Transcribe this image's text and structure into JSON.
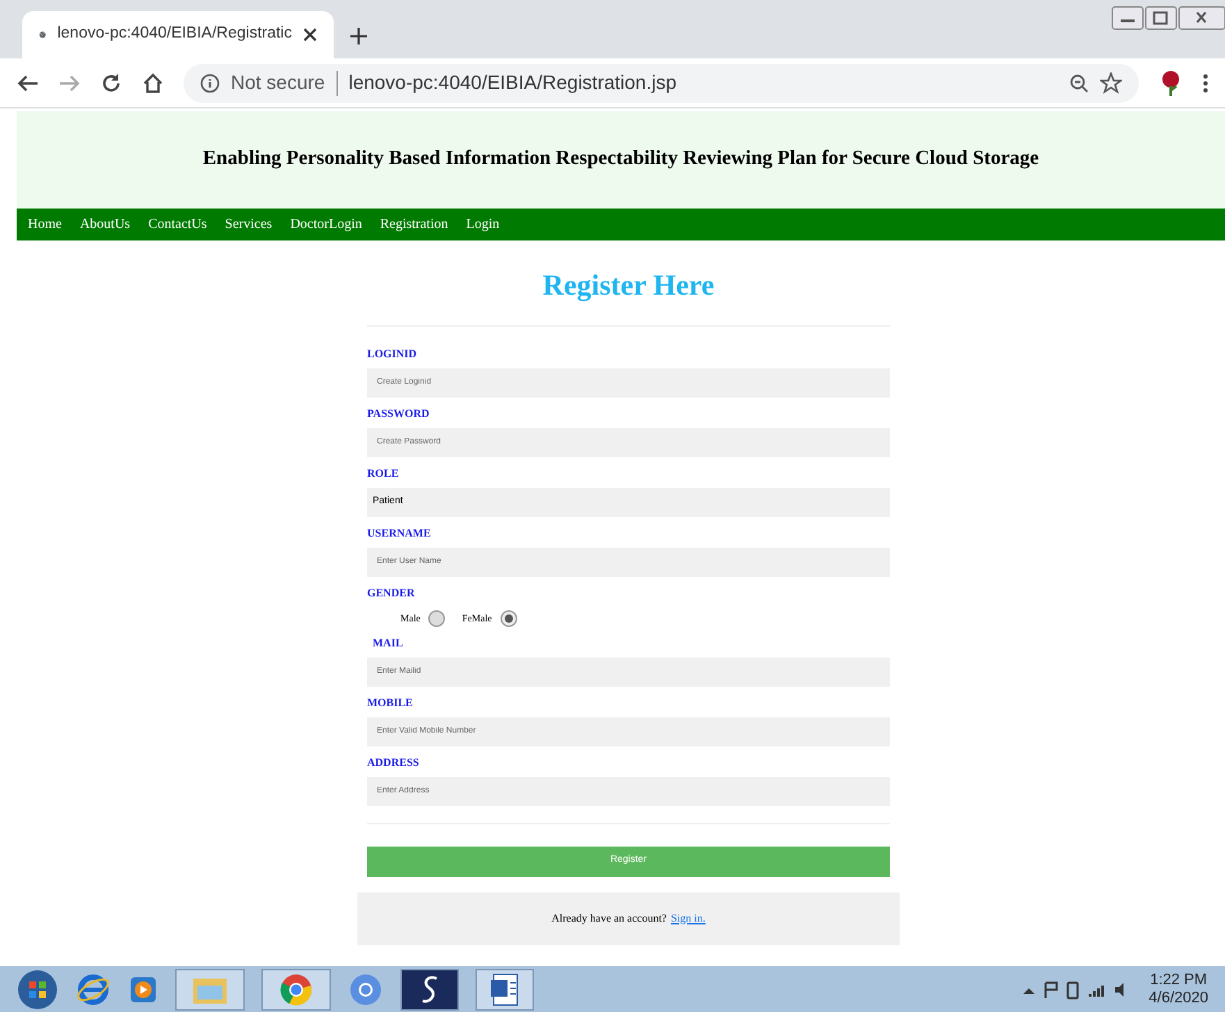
{
  "browser": {
    "tab_title": "lenovo-pc:4040/EIBIA/Registratic",
    "security": "Not secure",
    "url": "lenovo-pc:4040/EIBIA/Registration.jsp"
  },
  "header": {
    "title": "Enabling Personality Based Information Respectability Reviewing Plan for Secure Cloud Storage"
  },
  "nav": [
    "Home",
    "AboutUs",
    "ContactUs",
    "Services",
    "DoctorLogin",
    "Registration",
    "Login"
  ],
  "form": {
    "title": "Register Here",
    "fields": [
      {
        "kind": "input",
        "label": "LOGINID",
        "placeholder": "Create Loginid"
      },
      {
        "kind": "input",
        "label": "PASSWORD",
        "placeholder": "Create Password"
      },
      {
        "kind": "select",
        "label": "ROLE",
        "value": "Patient"
      },
      {
        "kind": "input",
        "label": "USERNAME",
        "placeholder": "Enter User Name"
      },
      {
        "kind": "radio",
        "label": "GENDER",
        "options": [
          {
            "label": "Male",
            "selected": false
          },
          {
            "label": "FeMale",
            "selected": true
          }
        ]
      },
      {
        "kind": "input",
        "label": "MAIL",
        "placeholder": "Enter Mailid"
      },
      {
        "kind": "input",
        "label": "MOBILE",
        "placeholder": "Enter Valid Mobile Number"
      },
      {
        "kind": "input",
        "label": "ADDRESS",
        "placeholder": "Enter Address"
      }
    ],
    "submit": "Register",
    "footer_text": "Already have an account?",
    "footer_link": "Sign in."
  },
  "taskbar": {
    "time": "1:22 PM",
    "date": "4/6/2020"
  }
}
